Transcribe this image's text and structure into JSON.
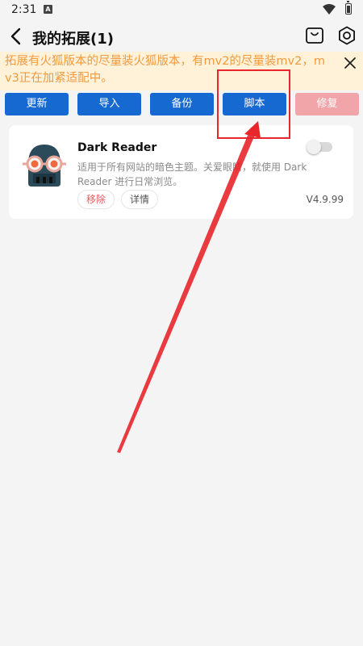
{
  "status_bar": {
    "time": "2:31",
    "a_icon": "A"
  },
  "header": {
    "title": "我的拓展(1)"
  },
  "notice": {
    "text": "拓展有火狐版本的尽量装火狐版本，有mv2的尽量装mv2，mv3正在加紧适配中。",
    "color": "#f29a3f"
  },
  "toolbar": {
    "update": "更新",
    "import": "导入",
    "backup": "备份",
    "script": "脚本",
    "repair": "修复"
  },
  "extension": {
    "name": "Dark Reader",
    "description": "适用于所有网站的暗色主题。关爱眼睛，就使用 Dark Reader 进行日常浏览。",
    "remove_label": "移除",
    "detail_label": "详情",
    "version": "V4.9.99",
    "enabled": false,
    "icon": "dark-reader-logo"
  },
  "colors": {
    "accent": "#1769d2",
    "disabled": "#f2a5a8",
    "annotation": "#e8262b"
  }
}
